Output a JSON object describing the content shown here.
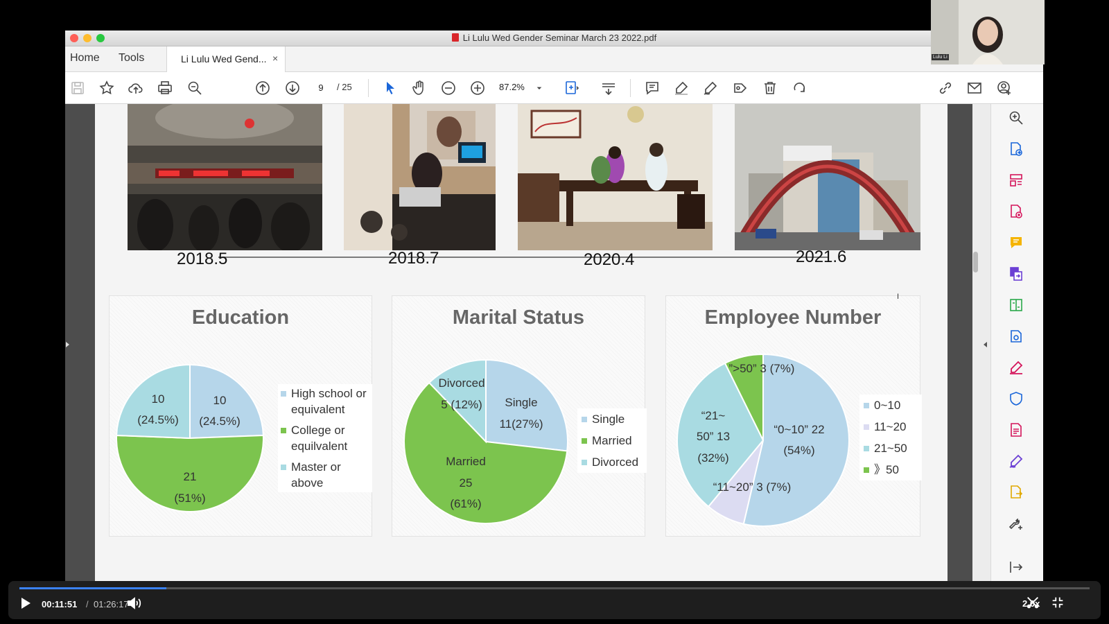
{
  "window": {
    "title": "Li Lulu Wed Gender Seminar March 23 2022.pdf",
    "nav": {
      "home": "Home",
      "tools": "Tools"
    },
    "tab_label": "Li Lulu Wed Gend...",
    "tab_close": "×"
  },
  "toolbar": {
    "page_current": "9",
    "page_total": "/ 25",
    "zoom": "87.2%",
    "icons": [
      "save-icon",
      "star-icon",
      "upload-icon",
      "print-icon",
      "zoom-out-icon",
      "page-up-icon",
      "page-down-icon",
      "select-cursor-icon",
      "hand-icon",
      "minus-circle-icon",
      "plus-circle-icon",
      "zoom-dropdown-icon",
      "fit-page-icon",
      "scroll-mode-icon",
      "comment-icon",
      "highlight-icon",
      "sign-icon",
      "stamp-icon",
      "trash-icon",
      "rotate-icon",
      "link-icon",
      "email-icon",
      "account-icon"
    ]
  },
  "slide": {
    "timeline": [
      {
        "year": "2018.5"
      },
      {
        "year": "2018.7"
      },
      {
        "year": "2020.4"
      },
      {
        "year": "2021.6"
      }
    ]
  },
  "chart_data": [
    {
      "type": "pie",
      "title": "Education",
      "categories": [
        "High school or equivalent",
        "College or equilvalent",
        "Master or above"
      ],
      "values": [
        10,
        21,
        10
      ],
      "percent_labels": [
        "(24.5%)",
        "(51%)",
        "(24.5%)"
      ],
      "colors": [
        "#b6d6ea",
        "#7cc44e",
        "#a9dbe2"
      ],
      "legend": "right"
    },
    {
      "type": "pie",
      "title": "Marital Status",
      "categories": [
        "Single",
        "Married",
        "Divorced"
      ],
      "values": [
        11,
        25,
        5
      ],
      "slice_labels": [
        [
          "Single",
          "11(27%)"
        ],
        [
          "Married",
          "25",
          "(61%)"
        ],
        [
          "Divorced",
          "5 (12%)"
        ]
      ],
      "colors": [
        "#b6d6ea",
        "#7cc44e",
        "#a9dbe2"
      ],
      "legend": "right"
    },
    {
      "type": "pie",
      "title": "Employee Number",
      "categories": [
        "0~10",
        "11~20",
        "21~50",
        "》50"
      ],
      "values": [
        22,
        3,
        13,
        3
      ],
      "slice_labels": [
        [
          "“0~10” 22",
          "(54%)"
        ],
        [
          "“11~20” 3 (7%)"
        ],
        [
          "“21~",
          "50” 13",
          "(32%)"
        ],
        [
          "”>50” 3 (7%)"
        ]
      ],
      "colors": [
        "#b6d6ea",
        "#dcdcf2",
        "#a9dbe2",
        "#7cc44e"
      ],
      "legend": "right"
    }
  ],
  "webcam": {
    "name": "Lulu Li"
  },
  "player": {
    "current_time": "00:11:51",
    "separator": "/",
    "total_time": "01:26:17",
    "progress": 0.137,
    "speed": "2.0x"
  }
}
